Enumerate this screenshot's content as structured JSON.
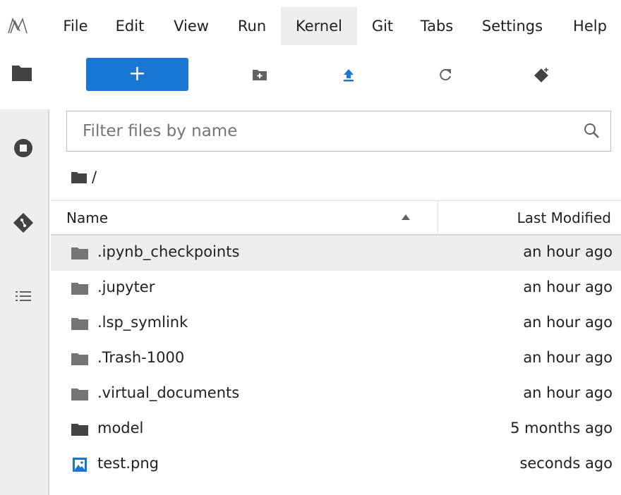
{
  "menubar": {
    "items": [
      "File",
      "Edit",
      "View",
      "Run",
      "Kernel",
      "Git",
      "Tabs",
      "Settings",
      "Help"
    ],
    "active": "Kernel"
  },
  "toolbar": {
    "new_launcher_label": "+",
    "accent": "#1976d2"
  },
  "filter": {
    "placeholder": "Filter files by name",
    "value": ""
  },
  "breadcrumb": {
    "path": "/"
  },
  "listing": {
    "columns": {
      "name": "Name",
      "modified": "Last Modified"
    },
    "sort": "name-ascending",
    "rows": [
      {
        "name": ".ipynb_checkpoints",
        "modified": "an hour ago",
        "type": "folder",
        "hidden": true,
        "selected": true
      },
      {
        "name": ".jupyter",
        "modified": "an hour ago",
        "type": "folder",
        "hidden": true
      },
      {
        "name": ".lsp_symlink",
        "modified": "an hour ago",
        "type": "folder",
        "hidden": true
      },
      {
        "name": ".Trash-1000",
        "modified": "an hour ago",
        "type": "folder",
        "hidden": true
      },
      {
        "name": ".virtual_documents",
        "modified": "an hour ago",
        "type": "folder",
        "hidden": true
      },
      {
        "name": "model",
        "modified": "5 months ago",
        "type": "folder",
        "hidden": false
      },
      {
        "name": "test.png",
        "modified": "seconds ago",
        "type": "image",
        "hidden": false
      }
    ]
  },
  "sidebar": {
    "icons": [
      "folder-icon",
      "running-icon",
      "git-icon",
      "toc-icon"
    ]
  }
}
